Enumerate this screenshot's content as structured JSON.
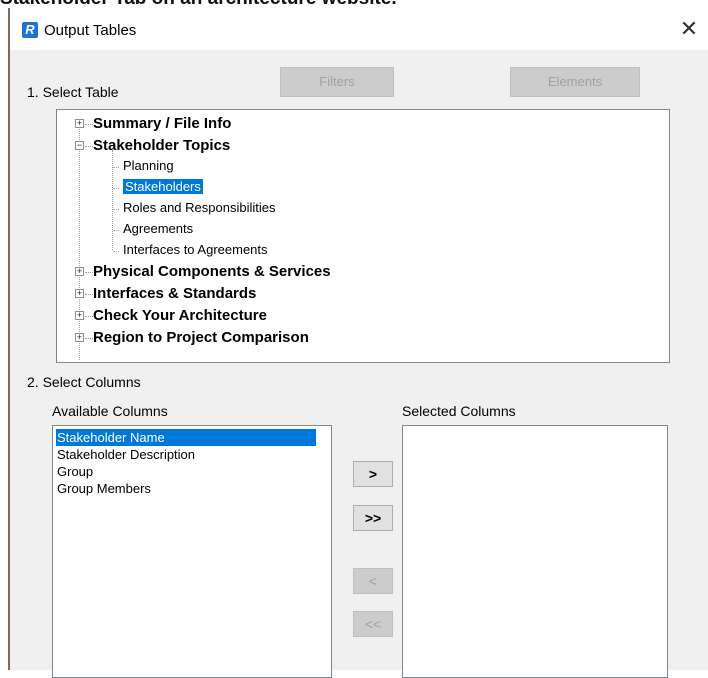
{
  "caption": "Stakeholder Tab on an architecture website.",
  "window": {
    "title": "Output Tables",
    "app_icon_letter": "R",
    "close_symbol": "✕"
  },
  "section1": {
    "label": "1. Select Table"
  },
  "toolbar": {
    "filters_label": "Filters",
    "elements_label": "Elements"
  },
  "tree": {
    "nodes": [
      {
        "label": "Summary / File Info",
        "expanded": false
      },
      {
        "label": "Stakeholder Topics",
        "expanded": true,
        "children": [
          "Planning",
          "Stakeholders",
          "Roles and Responsibilities",
          "Agreements",
          "Interfaces to Agreements"
        ],
        "selected_child": "Stakeholders"
      },
      {
        "label": "Physical Components & Services",
        "expanded": false
      },
      {
        "label": "Interfaces & Standards",
        "expanded": false
      },
      {
        "label": "Check Your Architecture",
        "expanded": false
      },
      {
        "label": "Region to Project Comparison",
        "expanded": false
      }
    ]
  },
  "section2": {
    "label": "2. Select Columns"
  },
  "available": {
    "label": "Available Columns",
    "items": [
      "Stakeholder Name",
      "Stakeholder Description",
      "Group",
      "Group Members"
    ],
    "selected": "Stakeholder Name"
  },
  "selected_columns": {
    "label": "Selected Columns",
    "items": []
  },
  "move_buttons": {
    "add_one": ">",
    "add_all": ">>",
    "remove_one": "<",
    "remove_all": "<<"
  },
  "colors": {
    "selection": "#0078d7",
    "dialog_bg": "#f0f0f0",
    "app_icon": "#1e73d2"
  }
}
